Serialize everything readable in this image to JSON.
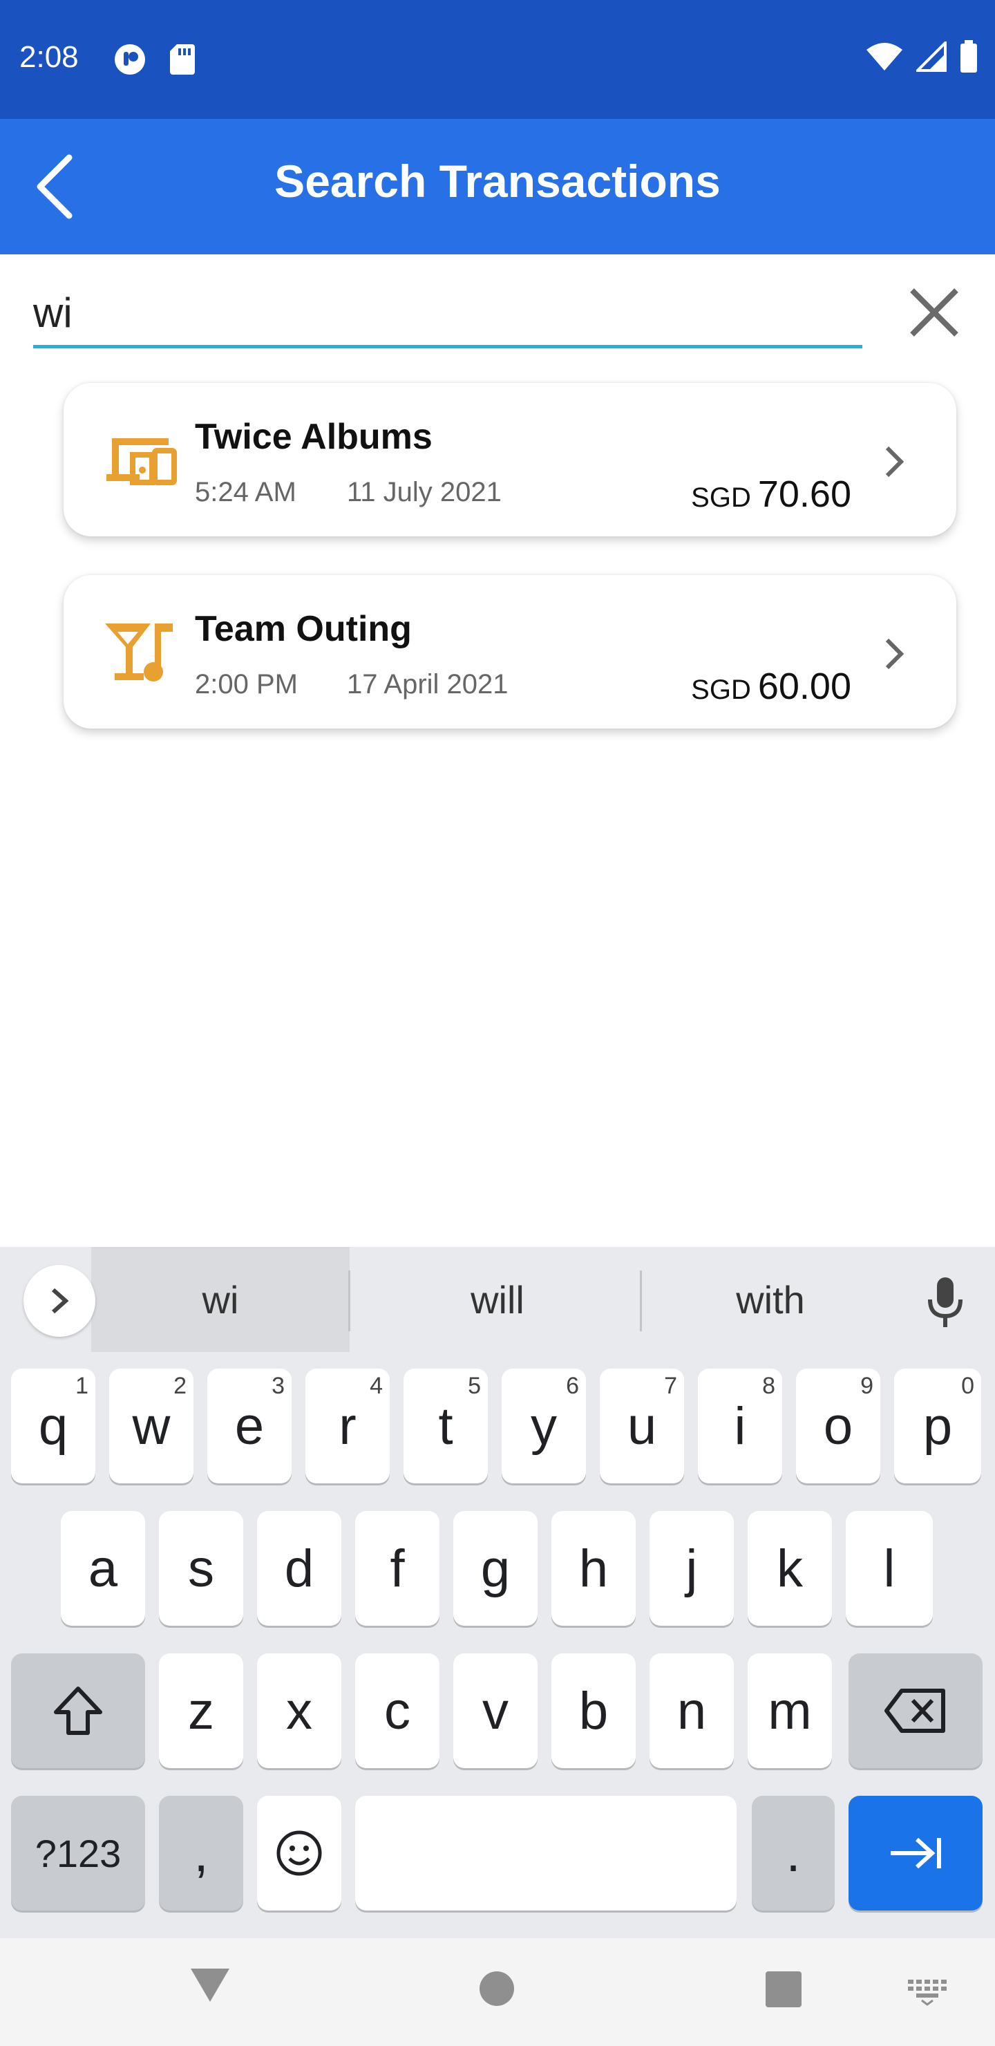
{
  "status": {
    "time": "2:08"
  },
  "appbar": {
    "title": "Search Transactions"
  },
  "search": {
    "value": "wi"
  },
  "results": [
    {
      "title": "Twice Albums",
      "time": "5:24 AM",
      "date": "11 July 2021",
      "currency": "SGD",
      "amount": "70.60",
      "icon": "devices-icon"
    },
    {
      "title": "Team Outing",
      "time": "2:00 PM",
      "date": "17 April 2021",
      "currency": "SGD",
      "amount": "60.00",
      "icon": "nightlife-icon"
    }
  ],
  "colors": {
    "status_bar": "#1a52c0",
    "app_bar": "#2870e6",
    "accent_icon": "#e8a030",
    "search_underline": "#1fb5d8",
    "enter_key": "#1a73e8"
  },
  "keyboard": {
    "suggestions": [
      "wi",
      "will",
      "with"
    ],
    "row1": [
      {
        "k": "q",
        "h": "1"
      },
      {
        "k": "w",
        "h": "2"
      },
      {
        "k": "e",
        "h": "3"
      },
      {
        "k": "r",
        "h": "4"
      },
      {
        "k": "t",
        "h": "5"
      },
      {
        "k": "y",
        "h": "6"
      },
      {
        "k": "u",
        "h": "7"
      },
      {
        "k": "i",
        "h": "8"
      },
      {
        "k": "o",
        "h": "9"
      },
      {
        "k": "p",
        "h": "0"
      }
    ],
    "row2": [
      "a",
      "s",
      "d",
      "f",
      "g",
      "h",
      "j",
      "k",
      "l"
    ],
    "row3": [
      "z",
      "x",
      "c",
      "v",
      "b",
      "n",
      "m"
    ],
    "symbols": "?123",
    "comma": ",",
    "period": "."
  }
}
